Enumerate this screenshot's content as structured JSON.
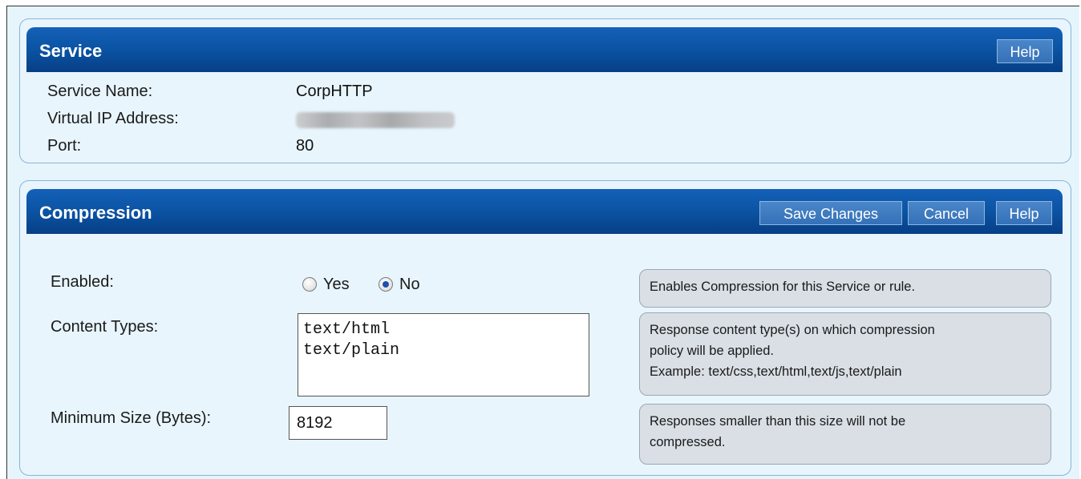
{
  "service": {
    "title": "Service",
    "help_label": "Help",
    "fields": [
      {
        "label": "Service Name:",
        "value": "CorpHTTP"
      },
      {
        "label": "Virtual IP Address:",
        "value": ""
      },
      {
        "label": "Port:",
        "value": "80"
      }
    ]
  },
  "compression": {
    "title": "Compression",
    "save_label": "Save Changes",
    "cancel_label": "Cancel",
    "help_label": "Help",
    "enabled": {
      "label": "Enabled:",
      "yes_label": "Yes",
      "no_label": "No",
      "selected": "No",
      "tip": "Enables Compression for this Service or rule."
    },
    "content_types": {
      "label": "Content Types:",
      "lines": [
        "text/html",
        "text/plain"
      ],
      "tip_lines": [
        "Response content type(s) on which compression",
        "policy will be applied.",
        "Example: text/css,text/html,text/js,text/plain"
      ]
    },
    "minimum_size": {
      "label": "Minimum Size (Bytes):",
      "value": "8192",
      "tip_lines": [
        "Responses smaller than this size will not be",
        "compressed."
      ]
    }
  },
  "colors": {
    "header_blue": "#0b53a3",
    "panel_bg": "#e8f5fd",
    "tip_bg": "#d9dfe5"
  }
}
